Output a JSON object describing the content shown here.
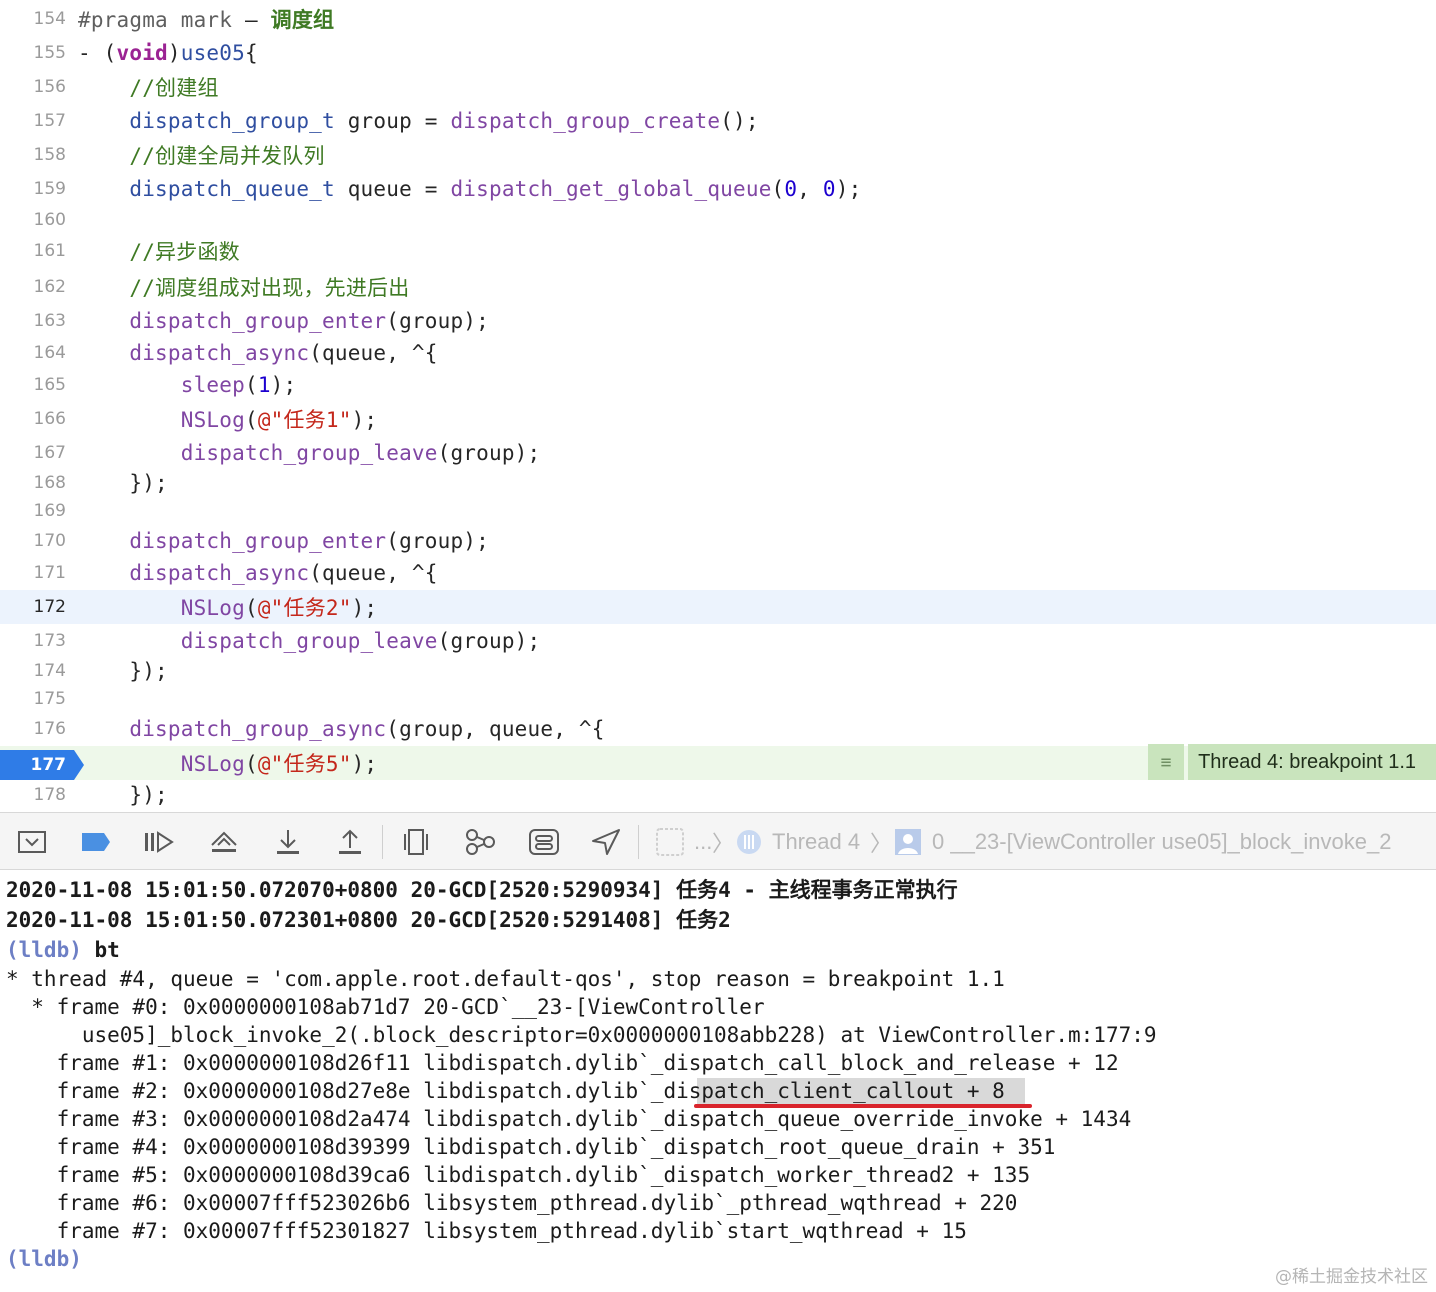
{
  "editor": {
    "lines": [
      {
        "num": "154",
        "parts": [
          {
            "t": "#pragma mark",
            "c": "pm"
          },
          {
            "t": " – ",
            "c": ""
          },
          {
            "t": "调度组",
            "c": "cm-b"
          }
        ]
      },
      {
        "num": "155",
        "parts": [
          {
            "t": "- (",
            "c": ""
          },
          {
            "t": "void",
            "c": "kw"
          },
          {
            "t": ")",
            "c": ""
          },
          {
            "t": "use05",
            "c": "tp"
          },
          {
            "t": "{",
            "c": ""
          }
        ]
      },
      {
        "num": "156",
        "parts": [
          {
            "t": "    //创建组",
            "c": "cm"
          }
        ]
      },
      {
        "num": "157",
        "parts": [
          {
            "t": "    ",
            "c": ""
          },
          {
            "t": "dispatch_group_t",
            "c": "tp"
          },
          {
            "t": " group = ",
            "c": ""
          },
          {
            "t": "dispatch_group_create",
            "c": "fn"
          },
          {
            "t": "();",
            "c": ""
          }
        ]
      },
      {
        "num": "158",
        "parts": [
          {
            "t": "    //创建全局并发队列",
            "c": "cm"
          }
        ]
      },
      {
        "num": "159",
        "parts": [
          {
            "t": "    ",
            "c": ""
          },
          {
            "t": "dispatch_queue_t",
            "c": "tp"
          },
          {
            "t": " queue = ",
            "c": ""
          },
          {
            "t": "dispatch_get_global_queue",
            "c": "fn"
          },
          {
            "t": "(",
            "c": ""
          },
          {
            "t": "0",
            "c": "nm"
          },
          {
            "t": ", ",
            "c": ""
          },
          {
            "t": "0",
            "c": "nm"
          },
          {
            "t": ");",
            "c": ""
          }
        ]
      },
      {
        "num": "160",
        "parts": []
      },
      {
        "num": "161",
        "parts": [
          {
            "t": "    //异步函数",
            "c": "cm"
          }
        ]
      },
      {
        "num": "162",
        "parts": [
          {
            "t": "    //调度组成对出现，先进后出",
            "c": "cm"
          }
        ]
      },
      {
        "num": "163",
        "parts": [
          {
            "t": "    ",
            "c": ""
          },
          {
            "t": "dispatch_group_enter",
            "c": "fn"
          },
          {
            "t": "(group);",
            "c": ""
          }
        ]
      },
      {
        "num": "164",
        "parts": [
          {
            "t": "    ",
            "c": ""
          },
          {
            "t": "dispatch_async",
            "c": "fn"
          },
          {
            "t": "(queue, ^{",
            "c": ""
          }
        ]
      },
      {
        "num": "165",
        "parts": [
          {
            "t": "        ",
            "c": ""
          },
          {
            "t": "sleep",
            "c": "fn"
          },
          {
            "t": "(",
            "c": ""
          },
          {
            "t": "1",
            "c": "nm"
          },
          {
            "t": ");",
            "c": ""
          }
        ]
      },
      {
        "num": "166",
        "parts": [
          {
            "t": "        ",
            "c": ""
          },
          {
            "t": "NSLog",
            "c": "fn"
          },
          {
            "t": "(",
            "c": ""
          },
          {
            "t": "@\"任务1\"",
            "c": "st"
          },
          {
            "t": ");",
            "c": ""
          }
        ]
      },
      {
        "num": "167",
        "parts": [
          {
            "t": "        ",
            "c": ""
          },
          {
            "t": "dispatch_group_leave",
            "c": "fn"
          },
          {
            "t": "(group);",
            "c": ""
          }
        ]
      },
      {
        "num": "168",
        "parts": [
          {
            "t": "    });",
            "c": ""
          }
        ]
      },
      {
        "num": "169",
        "parts": []
      },
      {
        "num": "170",
        "parts": [
          {
            "t": "    ",
            "c": ""
          },
          {
            "t": "dispatch_group_enter",
            "c": "fn"
          },
          {
            "t": "(group);",
            "c": ""
          }
        ]
      },
      {
        "num": "171",
        "parts": [
          {
            "t": "    ",
            "c": ""
          },
          {
            "t": "dispatch_async",
            "c": "fn"
          },
          {
            "t": "(queue, ^{",
            "c": ""
          }
        ]
      },
      {
        "num": "172",
        "parts": [
          {
            "t": "        ",
            "c": ""
          },
          {
            "t": "NSLog",
            "c": "fn"
          },
          {
            "t": "(",
            "c": ""
          },
          {
            "t": "@\"任务2\"",
            "c": "st"
          },
          {
            "t": ");",
            "c": ""
          }
        ]
      },
      {
        "num": "173",
        "parts": [
          {
            "t": "        ",
            "c": ""
          },
          {
            "t": "dispatch_group_leave",
            "c": "fn"
          },
          {
            "t": "(group);",
            "c": ""
          }
        ]
      },
      {
        "num": "174",
        "parts": [
          {
            "t": "    });",
            "c": ""
          }
        ]
      },
      {
        "num": "175",
        "parts": []
      },
      {
        "num": "176",
        "parts": [
          {
            "t": "    ",
            "c": ""
          },
          {
            "t": "dispatch_group_async",
            "c": "fn"
          },
          {
            "t": "(group, queue, ^{",
            "c": ""
          }
        ]
      },
      {
        "num": "177",
        "parts": [
          {
            "t": "        ",
            "c": ""
          },
          {
            "t": "NSLog",
            "c": "fn"
          },
          {
            "t": "(",
            "c": ""
          },
          {
            "t": "@\"任务5\"",
            "c": "st"
          },
          {
            "t": ");",
            "c": ""
          }
        ]
      },
      {
        "num": "178",
        "parts": [
          {
            "t": "    });",
            "c": ""
          }
        ]
      }
    ],
    "highlighted_line": "172",
    "breakpoint_line": "177",
    "breakpoint_label": "Thread 4: breakpoint 1.1"
  },
  "debug_bar": {
    "ellipsis": "...",
    "thread_label": "Thread 4",
    "frame_label": "0 __23-[ViewController use05]_block_invoke_2"
  },
  "console": {
    "lines": [
      "2020-11-08 15:01:50.072070+0800 20-GCD[2520:5290934] 任务4 - 主线程事务正常执行",
      "2020-11-08 15:01:50.072301+0800 20-GCD[2520:5291408] 任务2",
      "(lldb) bt",
      "* thread #4, queue = 'com.apple.root.default-qos', stop reason = breakpoint 1.1",
      "  * frame #0: 0x0000000108ab71d7 20-GCD`__23-[ViewController",
      "      use05]_block_invoke_2(.block_descriptor=0x0000000108abb228) at ViewController.m:177:9",
      "    frame #1: 0x0000000108d26f11 libdispatch.dylib`_dispatch_call_block_and_release + 12",
      "    frame #2: 0x0000000108d27e8e libdispatch.dylib`_dispatch_client_callout + 8",
      "    frame #3: 0x0000000108d2a474 libdispatch.dylib`_dispatch_queue_override_invoke + 1434",
      "    frame #4: 0x0000000108d39399 libdispatch.dylib`_dispatch_root_queue_drain + 351",
      "    frame #5: 0x0000000108d39ca6 libdispatch.dylib`_dispatch_worker_thread2 + 135",
      "    frame #6: 0x00007fff523026b6 libsystem_pthread.dylib`_pthread_wqthread + 220",
      "    frame #7: 0x00007fff52301827 libsystem_pthread.dylib`start_wqthread + 15",
      "(lldb)"
    ]
  },
  "watermark": "@稀土掘金技术社区",
  "colors": {
    "keyword": "#9b2393",
    "function": "#8046a3",
    "type": "#2f4ea0",
    "comment": "#3f7a24",
    "string": "#c4271b",
    "number": "#1c00cf",
    "breakpoint": "#2f7ce7",
    "breakpoint_bg": "#c9e4bd"
  }
}
